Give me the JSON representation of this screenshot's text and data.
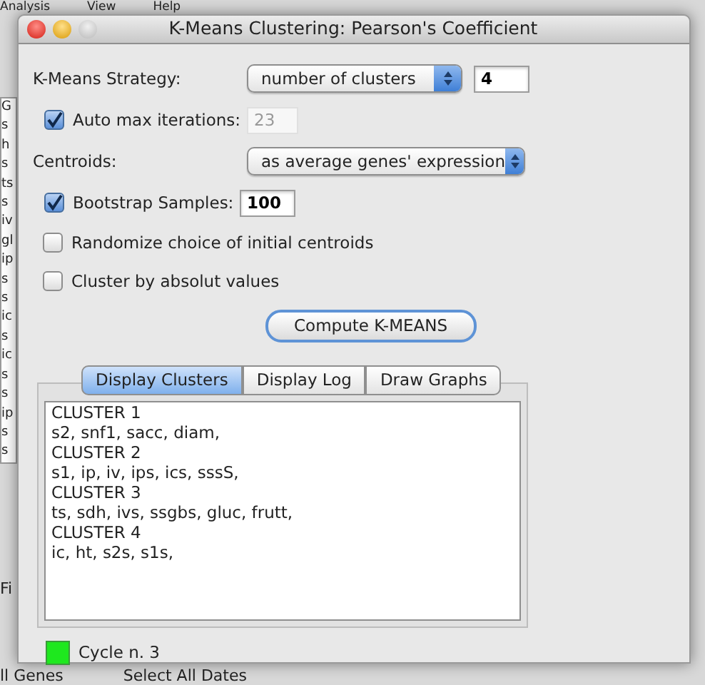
{
  "background": {
    "menu": [
      "Analysis",
      "View",
      "Help"
    ],
    "left_column": [
      "G",
      "s",
      "h",
      "s",
      "ts",
      "s",
      "iv",
      "gl",
      "ip",
      "s",
      "s",
      "ic",
      "s",
      "ic",
      "s",
      "s",
      "ip",
      "s",
      "s"
    ],
    "bottom_left": "Fi",
    "footer": [
      "ll Genes",
      "Select All Dates"
    ]
  },
  "window": {
    "title": "K-Means Clustering: Pearson's Coefficient"
  },
  "strategy": {
    "label": "K-Means Strategy:",
    "value": "number of clusters",
    "count": "4"
  },
  "auto_max": {
    "label": "Auto max iterations:",
    "checked": true,
    "value": "23",
    "disabled": true
  },
  "centroids": {
    "label": "Centroids:",
    "value": "as average genes' expression"
  },
  "bootstrap": {
    "label": "Bootstrap Samples:",
    "checked": true,
    "value": "100"
  },
  "options": [
    {
      "label": "Randomize choice of initial centroids",
      "checked": false
    },
    {
      "label": "Cluster by absolut values",
      "checked": false
    }
  ],
  "compute_button": "Compute K-MEANS",
  "tabs": [
    {
      "label": "Display Clusters",
      "selected": true
    },
    {
      "label": "Display Log",
      "selected": false
    },
    {
      "label": "Draw Graphs",
      "selected": false
    }
  ],
  "output_lines": [
    "CLUSTER 1",
    "s2, snf1, sacc, diam,",
    "CLUSTER 2",
    "s1, ip, iv, ips, ics, sssS,",
    "CLUSTER 3",
    "ts, sdh, ivs, ssgbs, gluc, frutt,",
    "CLUSTER 4",
    "ic, ht, s2s, s1s,"
  ],
  "status": {
    "color": "#1ee81e",
    "text": "Cycle n. 3"
  }
}
